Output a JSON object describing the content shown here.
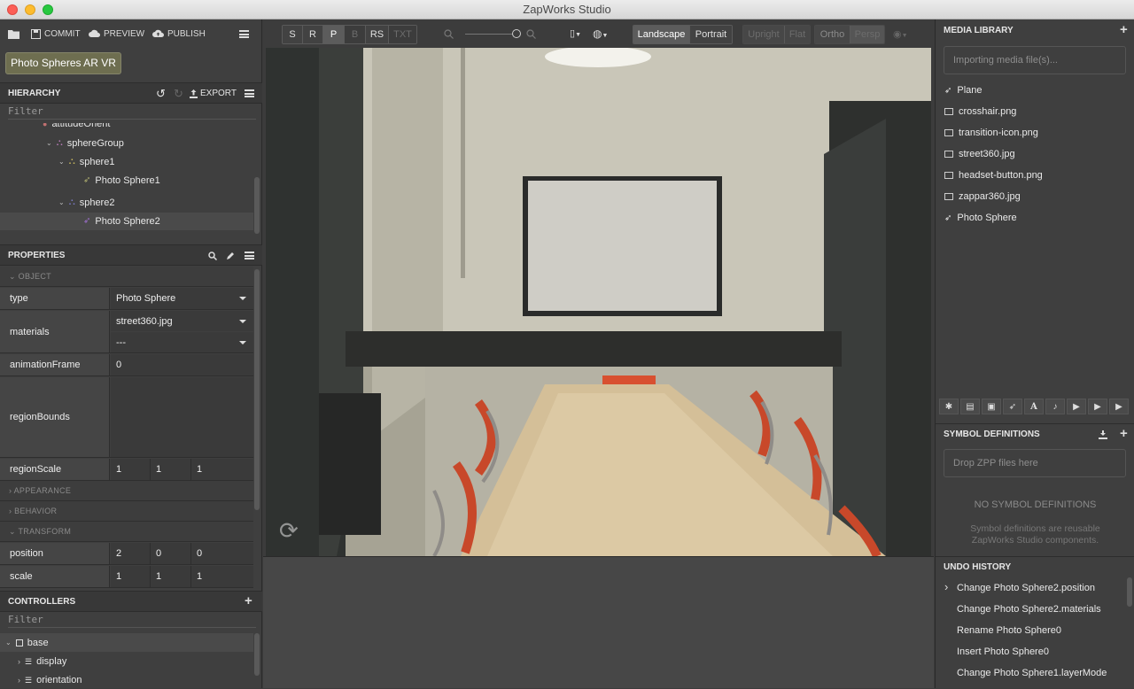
{
  "window": {
    "title": "ZapWorks Studio"
  },
  "toolbar": {
    "commit": "COMMIT",
    "preview": "PREVIEW",
    "publish": "PUBLISH"
  },
  "project": {
    "name": "Photo Spheres AR VR"
  },
  "hierarchy": {
    "title": "HIERARCHY",
    "export": "EXPORT",
    "filter_placeholder": "Filter",
    "items": [
      {
        "label": "attitudeOrient"
      },
      {
        "label": "sphereGroup"
      },
      {
        "label": "sphere1"
      },
      {
        "label": "Photo Sphere1"
      },
      {
        "label": "sphere2"
      },
      {
        "label": "Photo Sphere2"
      }
    ]
  },
  "properties": {
    "title": "PROPERTIES",
    "sections": {
      "object": "OBJECT",
      "appearance": "APPEARANCE",
      "behavior": "BEHAVIOR",
      "transform": "TRANSFORM"
    },
    "rows": {
      "type": {
        "label": "type",
        "value": "Photo Sphere"
      },
      "materials": {
        "label": "materials",
        "value1": "street360.jpg",
        "value2": "---"
      },
      "animationFrame": {
        "label": "animationFrame",
        "value": "0"
      },
      "regionBounds": {
        "label": "regionBounds"
      },
      "regionScale": {
        "label": "regionScale",
        "x": "1",
        "y": "1",
        "z": "1"
      },
      "position": {
        "label": "position",
        "x": "2",
        "y": "0",
        "z": "0"
      },
      "scale": {
        "label": "scale",
        "x": "1",
        "y": "1",
        "z": "1"
      }
    }
  },
  "controllers": {
    "title": "CONTROLLERS",
    "filter_placeholder": "Filter",
    "items": [
      {
        "label": "base"
      },
      {
        "label": "display"
      },
      {
        "label": "orientation"
      }
    ]
  },
  "canvas_toolbar": {
    "transform_modes": [
      "S",
      "R",
      "P",
      "B",
      "RS",
      "TXT"
    ],
    "orientation": [
      "Landscape",
      "Portrait"
    ],
    "view_modes": [
      "Upright",
      "Flat"
    ],
    "projection": [
      "Ortho",
      "Persp"
    ]
  },
  "media_library": {
    "title": "MEDIA LIBRARY",
    "import_status": "Importing media file(s)...",
    "items": [
      {
        "label": "Plane",
        "icon": "rocket-icon"
      },
      {
        "label": "crosshair.png",
        "icon": "image-icon"
      },
      {
        "label": "transition-icon.png",
        "icon": "image-icon"
      },
      {
        "label": "street360.jpg",
        "icon": "image-icon"
      },
      {
        "label": "headset-button.png",
        "icon": "image-icon"
      },
      {
        "label": "zappar360.jpg",
        "icon": "image-icon"
      },
      {
        "label": "Photo Sphere",
        "icon": "rocket-icon"
      }
    ]
  },
  "symbol_definitions": {
    "title": "SYMBOL DEFINITIONS",
    "drop_hint": "Drop ZPP files here",
    "empty_title": "NO SYMBOL DEFINITIONS",
    "empty_desc_line1": "Symbol definitions are reusable",
    "empty_desc_line2": "ZapWorks Studio components."
  },
  "undo_history": {
    "title": "UNDO HISTORY",
    "items": [
      "Change Photo Sphere2.position",
      "Change Photo Sphere2.materials",
      "Rename Photo Sphere0",
      "Insert Photo Sphere0",
      "Change Photo Sphere1.layerMode"
    ]
  },
  "colors": {
    "accent_project": "#6e6e50",
    "panel": "#3f3f3f",
    "header": "#383838"
  }
}
